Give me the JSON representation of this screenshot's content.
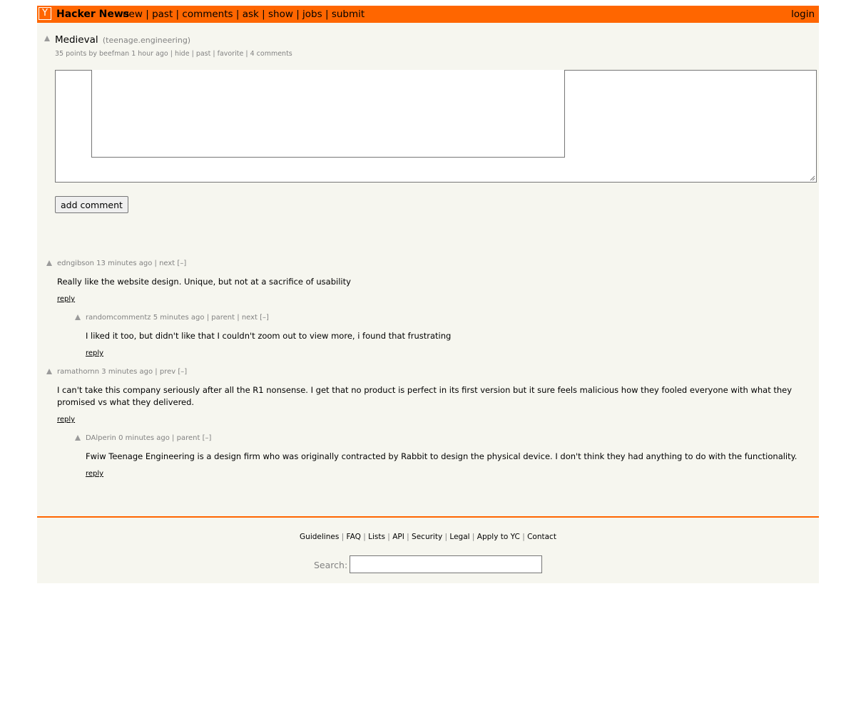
{
  "header": {
    "logo": "Y",
    "site_name": "Hacker News",
    "nav": [
      "new",
      "past",
      "comments",
      "ask",
      "show",
      "jobs",
      "submit"
    ],
    "login": "login"
  },
  "story": {
    "title": "Medieval",
    "site": "(teenage.engineering)",
    "points": "35 points",
    "by": "by",
    "user": "beefman",
    "age": "1 hour ago",
    "links": [
      "hide",
      "past",
      "favorite",
      "4 comments"
    ]
  },
  "form": {
    "button": "add comment"
  },
  "comments": [
    {
      "user": "edngibson",
      "age": "13 minutes ago",
      "nav": "next",
      "toggle": "[–]",
      "text": "Really like the website design. Unique, but not at a sacrifice of usability",
      "reply": "reply"
    },
    {
      "user": "randomcommentz",
      "age": "5 minutes ago",
      "nav1": "parent",
      "nav2": "next",
      "toggle": "[–]",
      "text": "I liked it too, but didn't like that I couldn't zoom out to view more, i found that frustrating",
      "reply": "reply"
    },
    {
      "user": "ramathornn",
      "age": "3 minutes ago",
      "nav": "prev",
      "toggle": "[–]",
      "text": "I can't take this company seriously after all the R1 nonsense. I get that no product is perfect in its first version but it sure feels malicious how they fooled everyone with what they promised vs what they delivered.",
      "reply": "reply"
    },
    {
      "user": "DAlperin",
      "age": "0 minutes ago",
      "nav": "parent",
      "toggle": "[–]",
      "text": "Fwiw Teenage Engineering is a design firm who was originally contracted by Rabbit to design the physical device. I don't think they had anything to do with the functionality.",
      "reply": "reply"
    }
  ],
  "footer": {
    "links": [
      "Guidelines",
      "FAQ",
      "Lists",
      "API",
      "Security",
      "Legal",
      "Apply to YC",
      "Contact"
    ],
    "search_label": "Search:"
  }
}
